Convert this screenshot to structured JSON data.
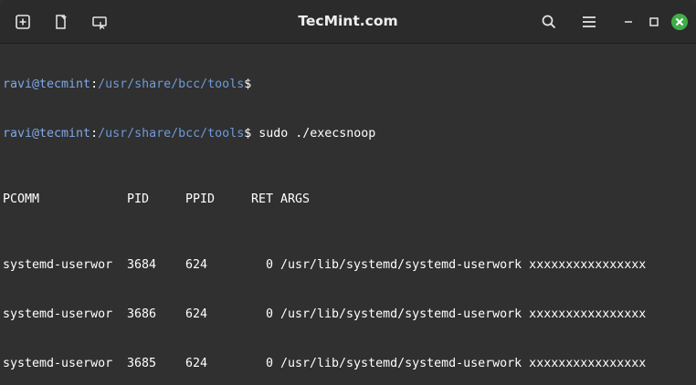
{
  "window": {
    "title": "TecMint.com",
    "colors": {
      "titlebar": "#2b2b2b",
      "background": "#303030",
      "prompt": "#7fa7e8",
      "text": "#ffffff",
      "close": "#3fae49"
    },
    "buttons": {
      "new_tab_icon": "plus-square-icon",
      "split_icon": "new-document-icon",
      "open_icon": "window-pointer-icon",
      "search_icon": "search-icon",
      "menu_icon": "hamburger-menu-icon",
      "minimize_icon": "minimize-icon",
      "maximize_icon": "maximize-icon",
      "close_icon": "close-icon"
    }
  },
  "terminal": {
    "prompts": [
      {
        "user_host": "ravi@tecmint",
        "sep": ":",
        "path": "/usr/share/bcc/tools",
        "dollar": "$",
        "command": ""
      },
      {
        "user_host": "ravi@tecmint",
        "sep": ":",
        "path": "/usr/share/bcc/tools",
        "dollar": "$",
        "command": " sudo ./execsnoop"
      }
    ],
    "header": {
      "pcomm": "PCOMM",
      "pid": "PID",
      "ppid": "PPID",
      "ret": "RET",
      "args": "ARGS"
    },
    "rows": [
      {
        "pcomm": "systemd-userwor",
        "pid": "3684",
        "ppid": "624",
        "ret": "0",
        "args": "/usr/lib/systemd/systemd-userwork xxxxxxxxxxxxxxxx"
      },
      {
        "pcomm": "systemd-userwor",
        "pid": "3686",
        "ppid": "624",
        "ret": "0",
        "args": "/usr/lib/systemd/systemd-userwork xxxxxxxxxxxxxxxx"
      },
      {
        "pcomm": "systemd-userwor",
        "pid": "3685",
        "ppid": "624",
        "ret": "0",
        "args": "/usr/lib/systemd/systemd-userwork xxxxxxxxxxxxxxxx"
      }
    ]
  }
}
